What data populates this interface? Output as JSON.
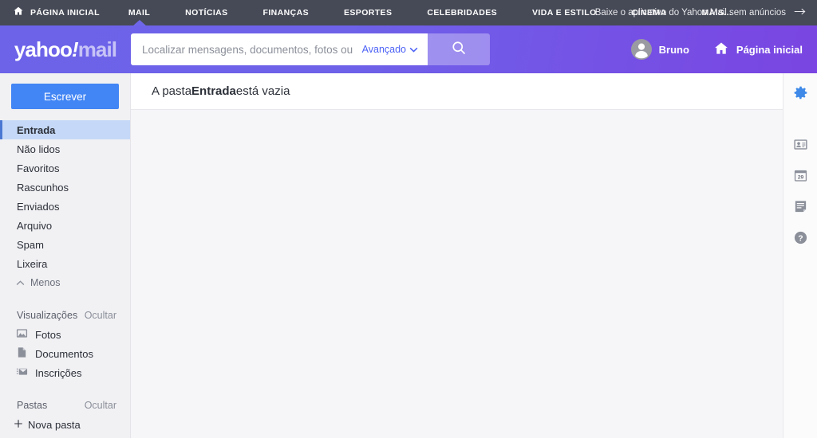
{
  "topnav": {
    "home_icon": "home-icon",
    "items": [
      {
        "label": "PÁGINA INICIAL",
        "active": false
      },
      {
        "label": "MAIL",
        "active": true
      },
      {
        "label": "NOTÍCIAS",
        "active": false
      },
      {
        "label": "FINANÇAS",
        "active": false
      },
      {
        "label": "ESPORTES",
        "active": false
      },
      {
        "label": "CELEBRIDADES",
        "active": false
      },
      {
        "label": "VIDA E ESTILO",
        "active": false
      },
      {
        "label": "CINEMA",
        "active": false
      },
      {
        "label": "MAIS...",
        "active": false
      }
    ],
    "promo": "Baixe o aplicativo do Yahoo Mail sem anúncios",
    "promo_icon": "arrow-right-icon"
  },
  "header": {
    "logo": {
      "brand": "yahoo",
      "bang": "!",
      "product": "mail"
    },
    "search": {
      "placeholder": "Localizar mensagens, documentos, fotos ou pes",
      "value": "",
      "advanced_label": "Avançado",
      "advanced_icon": "chevron-down-icon",
      "button_icon": "search-icon"
    },
    "account": {
      "name": "Bruno",
      "icon": "user-avatar-icon"
    },
    "home": {
      "label": "Página inicial",
      "icon": "home-icon"
    }
  },
  "sidebar": {
    "compose_label": "Escrever",
    "folders": [
      {
        "label": "Entrada",
        "active": true
      },
      {
        "label": "Não lidos",
        "active": false
      },
      {
        "label": "Favoritos",
        "active": false
      },
      {
        "label": "Rascunhos",
        "active": false
      },
      {
        "label": "Enviados",
        "active": false
      },
      {
        "label": "Arquivo",
        "active": false
      },
      {
        "label": "Spam",
        "active": false
      },
      {
        "label": "Lixeira",
        "active": false
      }
    ],
    "less_label": "Menos",
    "less_icon": "chevron-up-icon",
    "views": {
      "title": "Visualizações",
      "hide_label": "Ocultar",
      "items": [
        {
          "label": "Fotos",
          "icon": "photo-icon"
        },
        {
          "label": "Documentos",
          "icon": "document-icon"
        },
        {
          "label": "Inscrições",
          "icon": "subscriptions-icon"
        }
      ]
    },
    "folders_section": {
      "title": "Pastas",
      "hide_label": "Ocultar",
      "new_folder_label": "Nova pasta",
      "new_folder_icon": "plus-icon"
    }
  },
  "main": {
    "empty_prefix": "A pasta ",
    "empty_folder": "Entrada",
    "empty_suffix": " está vazia"
  },
  "rail": {
    "items": [
      {
        "name": "settings-gear-icon",
        "label": ""
      },
      {
        "name": "contacts-icon",
        "label": ""
      },
      {
        "name": "calendar-icon",
        "label": "29"
      },
      {
        "name": "notepad-icon",
        "label": ""
      },
      {
        "name": "help-icon",
        "label": "?"
      }
    ]
  },
  "colors": {
    "topnav_bg": "#464a56",
    "header_purple_start": "#6c63e9",
    "header_purple_end": "#7a45e2",
    "accent_blue": "#4285f4",
    "active_folder_bg": "#c5d8f7",
    "link_blue": "#4c62f5",
    "gear_blue": "#3f8ae8"
  }
}
